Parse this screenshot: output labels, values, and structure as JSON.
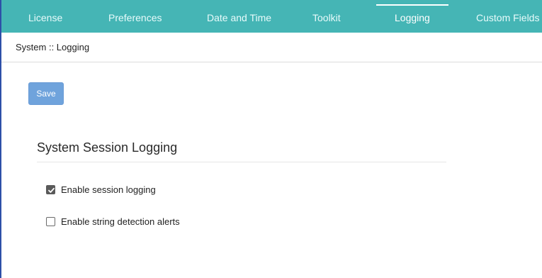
{
  "tabs": [
    {
      "label": "License",
      "active": false
    },
    {
      "label": "Preferences",
      "active": false
    },
    {
      "label": "Date and Time",
      "active": false
    },
    {
      "label": "Toolkit",
      "active": false
    },
    {
      "label": "Logging",
      "active": true
    },
    {
      "label": "Custom Fields",
      "active": false
    }
  ],
  "breadcrumb": "System :: Logging",
  "toolbar": {
    "save_label": "Save"
  },
  "section": {
    "title": "System Session Logging",
    "options": [
      {
        "label": "Enable session logging",
        "checked": true
      },
      {
        "label": "Enable string detection alerts",
        "checked": false
      }
    ]
  },
  "colors": {
    "tabbar": "#45b5b5",
    "save_button": "#6fa3dc",
    "checkbox_checked": "#5a5a5a"
  },
  "icons": {
    "checked": "checkmark-icon"
  }
}
